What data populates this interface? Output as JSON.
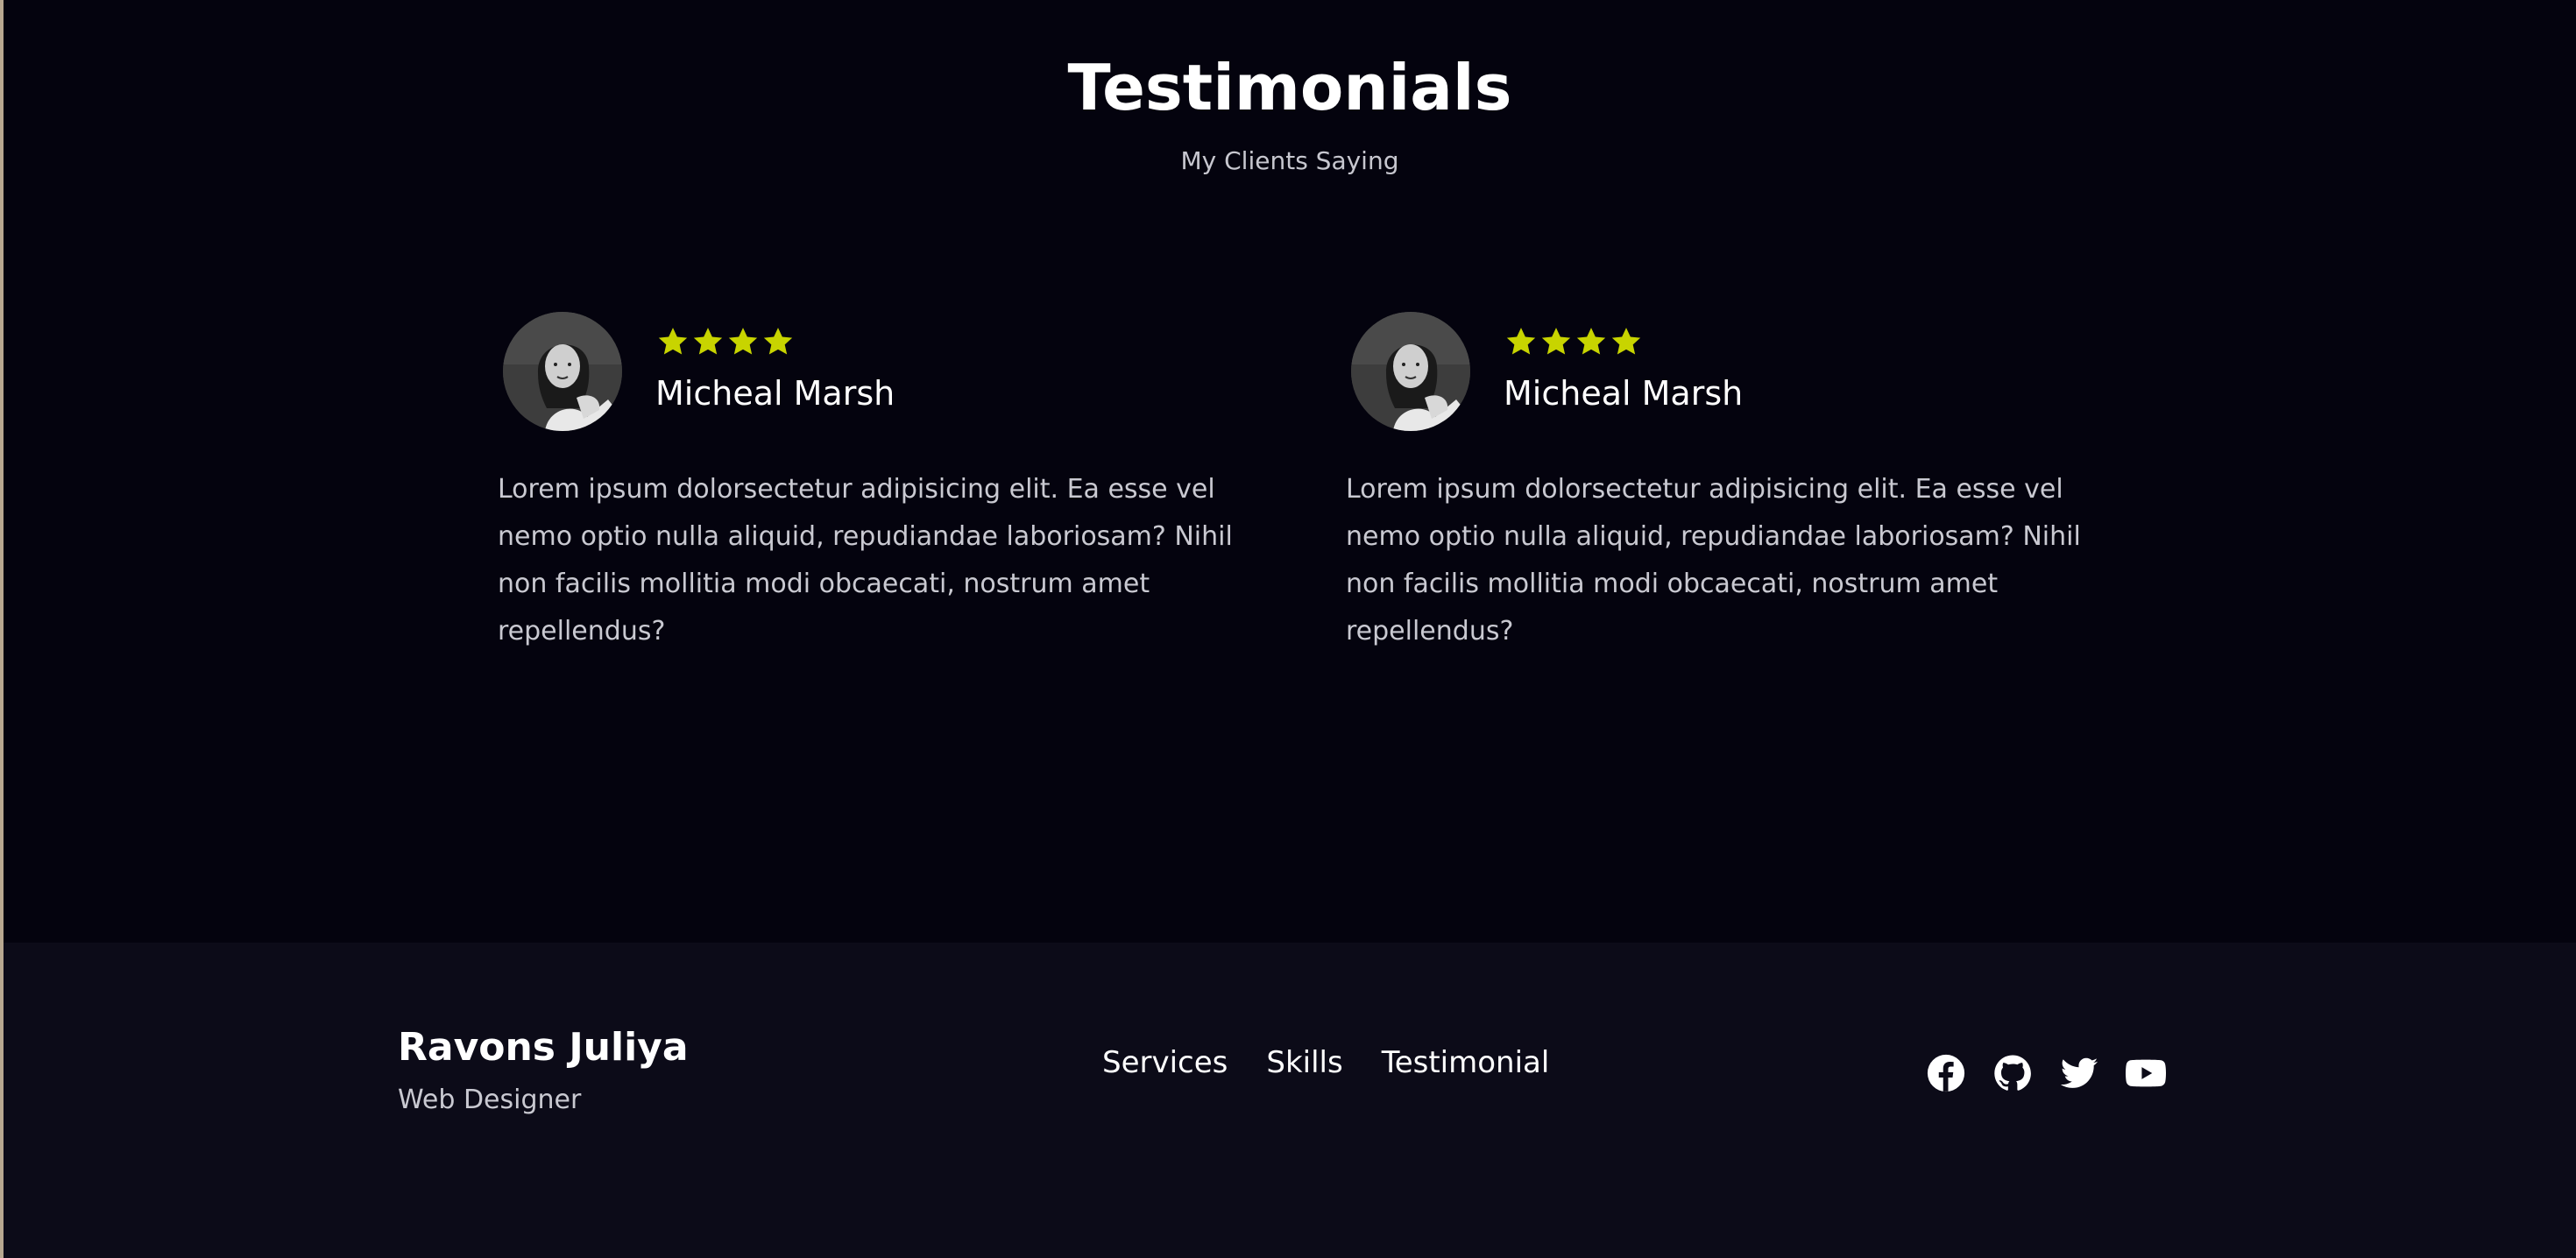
{
  "testimonials": {
    "title": "Testimonials",
    "subtitle": "My Clients Saying",
    "items": [
      {
        "name": "Micheal Marsh",
        "rating": 4,
        "text": "Lorem ipsum dolorsectetur adipisicing elit. Ea esse vel nemo optio nulla aliquid, repudiandae laboriosam? Nihil non facilis mollitia modi obcaecati, nostrum amet repellendus?"
      },
      {
        "name": "Micheal Marsh",
        "rating": 4,
        "text": "Lorem ipsum dolorsectetur adipisicing elit. Ea esse vel nemo optio nulla aliquid, repudiandae laboriosam? Nihil non facilis mollitia modi obcaecati, nostrum amet repellendus?"
      }
    ]
  },
  "footer": {
    "brand": "Ravons Juliya",
    "role": "Web Designer",
    "nav": [
      "Services",
      "Skills",
      "Testimonial"
    ],
    "socials": [
      "facebook-icon",
      "github-icon",
      "twitter-icon",
      "youtube-icon"
    ]
  },
  "colors": {
    "background": "#04030e",
    "footer_background": "#0c0b18",
    "star": "#c8d400",
    "text": "#ffffff",
    "muted": "#c9c9d1"
  }
}
